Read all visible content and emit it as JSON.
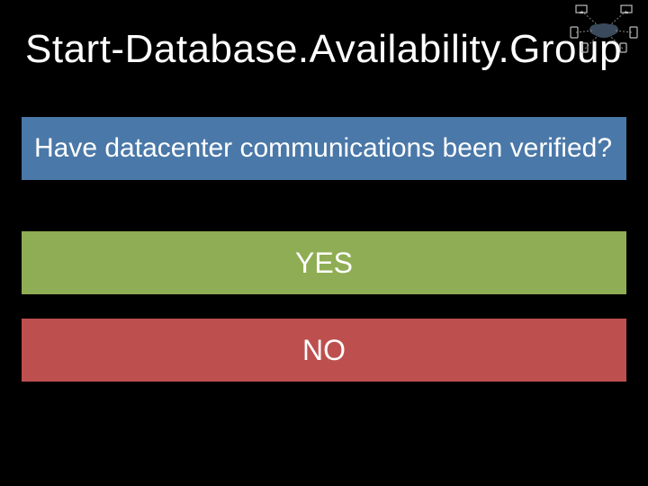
{
  "title": "Start-Database.Availability.Group",
  "question": "Have datacenter communications been verified?",
  "buttons": {
    "yes": "YES",
    "no": "NO"
  },
  "colors": {
    "question_bg": "#4a78a8",
    "yes_bg": "#8fad54",
    "no_bg": "#bd504e"
  }
}
